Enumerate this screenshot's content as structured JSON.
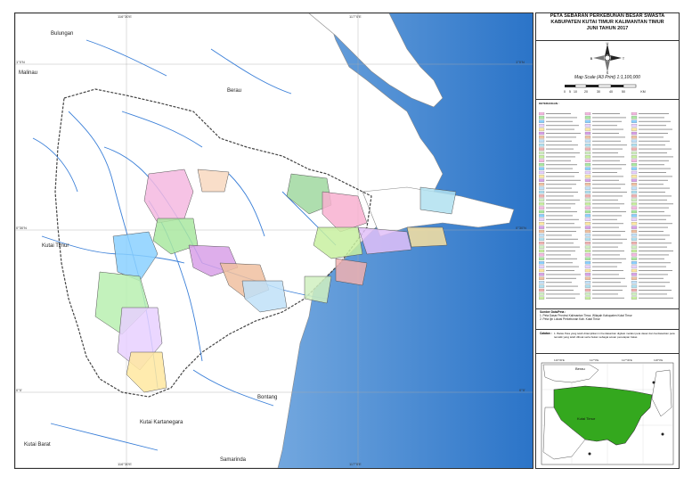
{
  "map": {
    "grid_labels_top": [
      "116°30'E",
      "117°0'E"
    ],
    "grid_labels_bottom": [
      "116°30'E",
      "117°0'E"
    ],
    "grid_labels_left": [
      "1°0'N",
      "0°30'N",
      "0°0'"
    ],
    "grid_labels_right": [
      "1°0'N",
      "0°30'N",
      "0°0'"
    ],
    "place_labels": [
      {
        "text": "Bulungan"
      },
      {
        "text": "Malinau"
      },
      {
        "text": "Berau"
      },
      {
        "text": "Kutai Timur"
      },
      {
        "text": "Bontang"
      },
      {
        "text": "Kutai Kartanegara"
      },
      {
        "text": "Kutai Barat"
      },
      {
        "text": "Samarinda"
      }
    ],
    "colors": {
      "sea_deep": "#2f7fd0",
      "sea_light": "#9cc8f0",
      "land": "#ffffff",
      "river": "#3a7fd8",
      "boundary": "#555555"
    }
  },
  "sidebar": {
    "title_lines": [
      "PETA SEBARAN PERKEBUNAN BESAR SWASTA",
      "KABUPATEN KUTAI TIMUR KALIMANTAN TIMUR",
      "JUNI TAHUN 2017"
    ],
    "north_letters": [
      "U",
      "S",
      "B",
      "T"
    ],
    "scale_text": "Map Scale (A3 Print) 1:1,100,000",
    "scale_ticks": [
      "0",
      "5",
      "10",
      "20",
      "30",
      "40",
      "50"
    ],
    "scale_unit": "KM",
    "legend_title": "KETERANGAN :",
    "source_title": "Sumber Data/Peta :",
    "source_lines": [
      "1. Peta Dasar Provinsi Kalimantan Timur, Wilayah Kabupaten Kutai Timur",
      "2. Peta Ijin Lokasi Perkebunan Kab. Kutai Timur"
    ],
    "note_label": "Catatan :",
    "note_text": "1. Batas Peta yang telah ditampilkan ini berdasarkan digitasi melalui peta dasar dan berdasarkan peta tematik yang telah dibuat serta bukan sebagai acuan penetapan batas",
    "inset_labels": [
      "Berau",
      "Kutai Timur"
    ],
    "inset_coords": [
      "116°30'E",
      "117°0'E",
      "117°30'E",
      "118°0'E"
    ],
    "colors": {
      "kutai_timur": "#34a81e",
      "inset_sea": "#ffffff",
      "inset_land": "#ffffff"
    }
  }
}
